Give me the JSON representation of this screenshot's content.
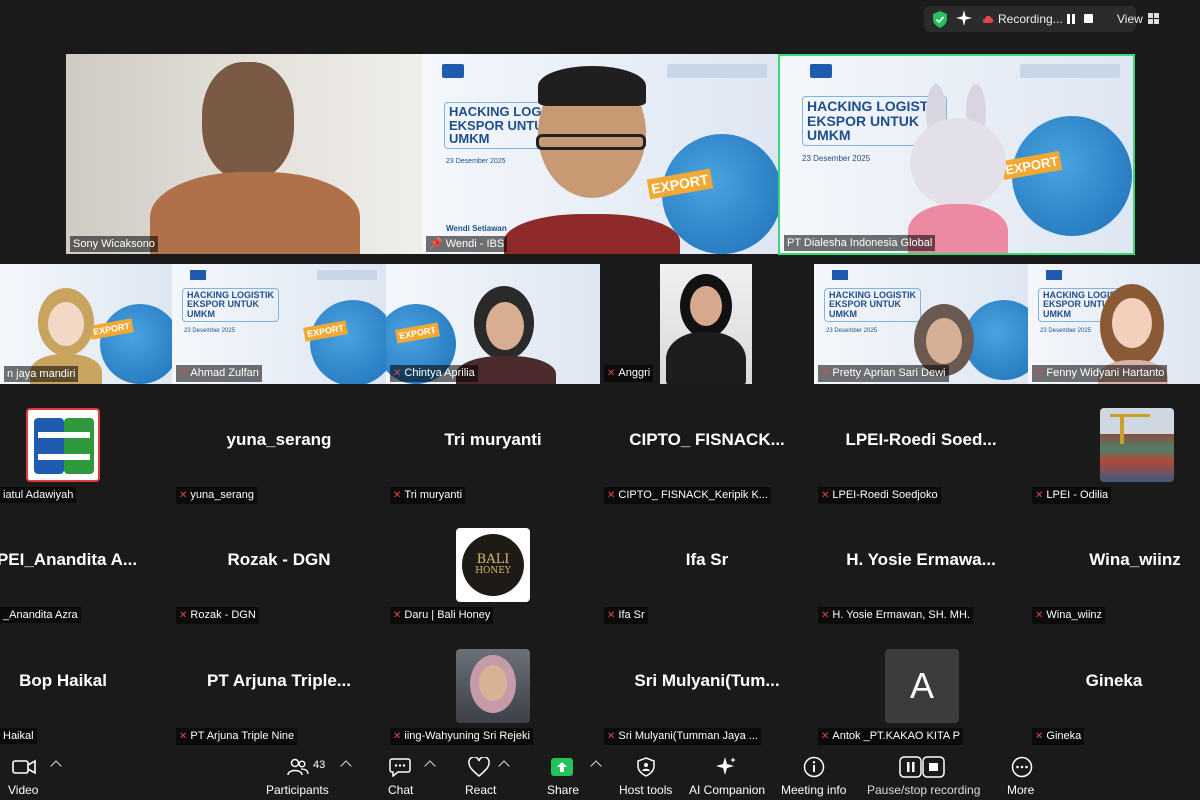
{
  "top_bar": {
    "recording_label": "Recording...",
    "view_label": "View",
    "icons": [
      "shield-check-icon",
      "ai-sparkle-icon",
      "cloud-record-icon",
      "pause-icon",
      "stop-icon",
      "grid-view-icon"
    ]
  },
  "slide": {
    "title_line1": "HACKING LOGISTIK",
    "title_line2": "EKSPOR UNTUK",
    "title_line3": "UMKM",
    "date": "23 Desember 2025",
    "export_tag": "EXPORT",
    "presenter_caption": "Wendi Setiawan"
  },
  "video_tiles_row1": [
    {
      "name": "Sony Wicaksono"
    },
    {
      "name": "Wendi - IBS"
    },
    {
      "name": "PT Dialesha Indonesia Global"
    }
  ],
  "video_tiles_row2": [
    {
      "name": "n jaya mandiri"
    },
    {
      "name": "Ahmad Zulfan"
    },
    {
      "name": "Chintya Aprilia"
    },
    {
      "name": "Anggri"
    },
    {
      "name": "Pretty Aprian Sari Dewi"
    },
    {
      "name": "Fenny Widyani Hartanto"
    }
  ],
  "name_tiles": [
    {
      "big": "",
      "name": "iatul Adawiyah"
    },
    {
      "big": "yuna_serang",
      "name": "yuna_serang"
    },
    {
      "big": "Tri muryanti",
      "name": "Tri muryanti"
    },
    {
      "big": "CIPTO_ FISNACK...",
      "name": "CIPTO_ FISNACK_Keripik K..."
    },
    {
      "big": "LPEI-Roedi Soed...",
      "name": "LPEI-Roedi Soedjoko"
    },
    {
      "big": "",
      "name": "LPEI - Odilia"
    },
    {
      "big": "PEI_Anandita A...",
      "name": "_Anandita Azra"
    },
    {
      "big": "Rozak - DGN",
      "name": "Rozak - DGN"
    },
    {
      "big": "",
      "name": "Daru | Bali Honey"
    },
    {
      "big": "Ifa Sr",
      "name": "Ifa Sr"
    },
    {
      "big": "H. Yosie Ermawa...",
      "name": "H. Yosie Ermawan, SH. MH."
    },
    {
      "big": "Wina_wiinz",
      "name": "Wina_wiinz"
    },
    {
      "big": "Bop Haikal",
      "name": "Haikal"
    },
    {
      "big": "PT Arjuna Triple...",
      "name": "PT Arjuna Triple Nine"
    },
    {
      "big": "",
      "name": "iing-Wahyuning Sri Rejeki"
    },
    {
      "big": "Sri Mulyani(Tum...",
      "name": "Sri Mulyani(Tumman Jaya ..."
    },
    {
      "big": "",
      "name": "Antok _PT.KAKAO KITA P"
    },
    {
      "big": "Gineka",
      "name": "Gineka"
    }
  ],
  "avatars": {
    "bali_honey_line1": "BALI",
    "bali_honey_line2": "HONEY",
    "antok_letter": "A"
  },
  "toolbar": {
    "video": "Video",
    "participants": "Participants",
    "participants_count": "43",
    "chat": "Chat",
    "react": "React",
    "share": "Share",
    "host_tools": "Host tools",
    "ai_companion": "AI Companion",
    "meeting_info": "Meeting info",
    "pause_stop": "Pause/stop recording",
    "more": "More"
  },
  "colors": {
    "background": "#1a1a1a",
    "active_speaker": "#3ad67a",
    "muted_mic": "#e04646",
    "share_green": "#24c25a",
    "slide_title": "#1f4e8c"
  }
}
